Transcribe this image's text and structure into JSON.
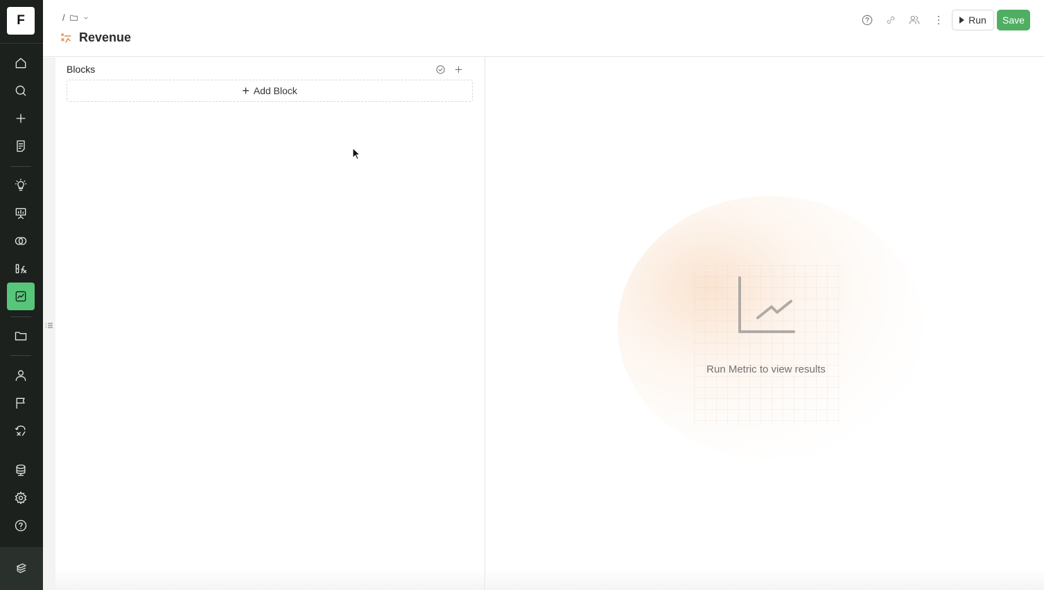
{
  "app": {
    "logo_letter": "F"
  },
  "sidebar": {
    "items": [
      {
        "name": "home",
        "icon": "home-icon"
      },
      {
        "name": "search",
        "icon": "search-icon"
      },
      {
        "name": "new",
        "icon": "plus-icon"
      },
      {
        "name": "notebooks",
        "icon": "notebook-icon"
      },
      {
        "name": "insights",
        "icon": "lightbulb-icon"
      },
      {
        "name": "dashboards",
        "icon": "presentation-icon"
      },
      {
        "name": "segments",
        "icon": "overlap-circles-icon"
      },
      {
        "name": "formulas",
        "icon": "formula-icon"
      },
      {
        "name": "metrics",
        "icon": "chart-line-icon",
        "active": true
      },
      {
        "name": "files",
        "icon": "folder-icon"
      },
      {
        "name": "users",
        "icon": "user-icon"
      },
      {
        "name": "flags",
        "icon": "flag-icon"
      },
      {
        "name": "experiments",
        "icon": "experiment-icon"
      },
      {
        "name": "data",
        "icon": "database-icon"
      },
      {
        "name": "settings",
        "icon": "gear-icon"
      },
      {
        "name": "help",
        "icon": "help-icon"
      }
    ],
    "accent": "#57c57a"
  },
  "header": {
    "breadcrumb_separator": "/",
    "title": "Revenue",
    "run_label": "Run",
    "save_label": "Save",
    "save_color": "#4fae62"
  },
  "blocks": {
    "title": "Blocks",
    "add_block_label": "Add Block"
  },
  "results": {
    "empty_message": "Run Metric to view results"
  }
}
